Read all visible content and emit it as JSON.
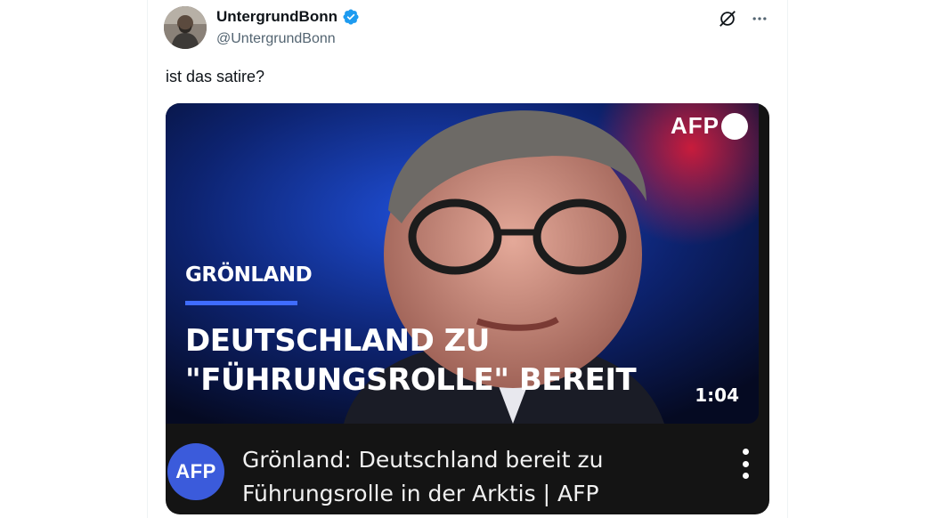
{
  "author": {
    "display_name": "UntergrundBonn",
    "handle": "@UntergrundBonn",
    "verified": true
  },
  "actions": {
    "grok_icon": "grok-icon",
    "more_icon": "more-horizontal-icon"
  },
  "tweet": {
    "text": "ist das satire?"
  },
  "video": {
    "logo_text": "AFP",
    "kicker": "GRÖNLAND",
    "headline": "DEUTSCHLAND ZU \"FÜHRUNGSROLLE\" BEREIT",
    "duration": "1:04"
  },
  "video_info": {
    "channel_avatar_text": "AFP",
    "title": "Grönland: Deutschland bereit zu Führungsrolle in der Arktis | AFP"
  },
  "colors": {
    "verified_blue": "#1d9bf0",
    "afp_blue": "#3b5bdb",
    "kicker_bar": "#3f6cff"
  }
}
